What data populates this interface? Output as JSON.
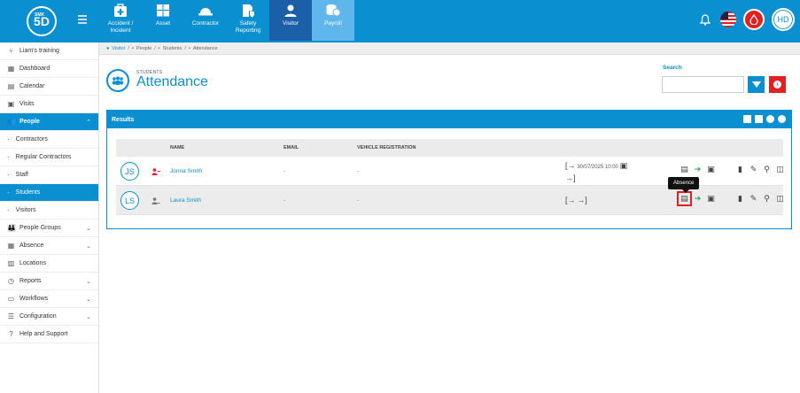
{
  "header": {
    "logo_text": "5D",
    "logo_small": "SMK",
    "modules": [
      {
        "label": "Accident / Incident",
        "icon": "first-aid-icon"
      },
      {
        "label": "Asset",
        "icon": "boxes-icon"
      },
      {
        "label": "Contractor",
        "icon": "hard-hat-icon"
      },
      {
        "label": "Safety Reporting",
        "icon": "shield-report-icon"
      },
      {
        "label": "Visitor",
        "icon": "person-icon"
      },
      {
        "label": "Payroll",
        "icon": "coins-icon"
      }
    ],
    "user_initials": "HD"
  },
  "sidebar": {
    "items": [
      {
        "label": "Liam's training",
        "icon": "⑂"
      },
      {
        "label": "Dashboard",
        "icon": "▦"
      },
      {
        "label": "Calendar",
        "icon": "▤"
      },
      {
        "label": "Visits",
        "icon": "▣"
      },
      {
        "label": "People",
        "icon": "👥"
      },
      {
        "label": "Contractors"
      },
      {
        "label": "Regular Contractors"
      },
      {
        "label": "Staff"
      },
      {
        "label": "Students"
      },
      {
        "label": "Visitors"
      },
      {
        "label": "People Groups",
        "icon": "👪"
      },
      {
        "label": "Absence",
        "icon": "▦"
      },
      {
        "label": "Locations",
        "icon": "▥"
      },
      {
        "label": "Reports",
        "icon": "◷"
      },
      {
        "label": "Workflows",
        "icon": "▭"
      },
      {
        "label": "Configuration",
        "icon": "☰"
      },
      {
        "label": "Help and Support",
        "icon": "?"
      }
    ]
  },
  "breadcrumb": {
    "items": [
      "Visitor",
      "People",
      "Students",
      "Attendance"
    ]
  },
  "page": {
    "subtitle": "STUDENTS",
    "title": "Attendance",
    "search_label": "Search",
    "search_value": ""
  },
  "results": {
    "title": "Results",
    "columns": [
      "NAME",
      "EMAIL",
      "VEHICLE REGISTRATION"
    ],
    "rows": [
      {
        "initials": "JS",
        "name": "Jonna Smith",
        "email": "-",
        "vehicle": "-",
        "time": "30/07/2025 10:00"
      },
      {
        "initials": "LS",
        "name": "Laura Smith",
        "email": "-",
        "vehicle": "-",
        "time": ""
      }
    ],
    "tooltip": "Absence"
  },
  "colors": {
    "primary": "#0a8fd0",
    "danger": "#e3201f",
    "success": "#2fa84f"
  }
}
